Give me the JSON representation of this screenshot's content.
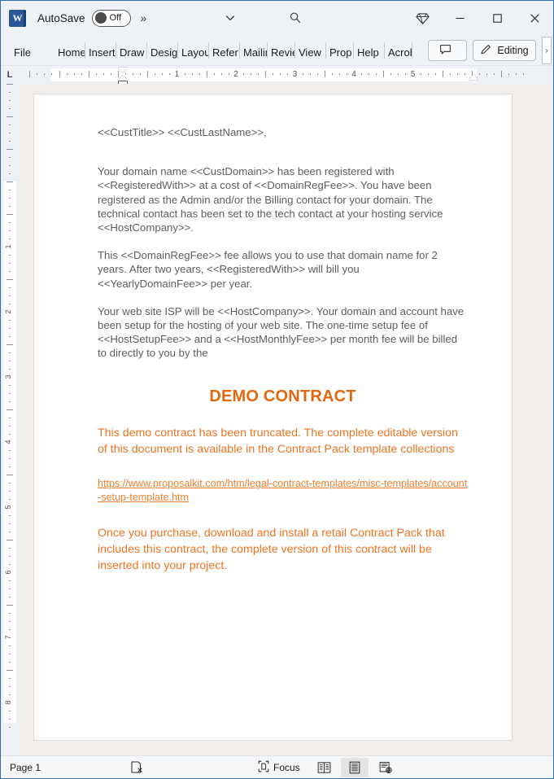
{
  "titlebar": {
    "app_icon": "word-logo-icon",
    "autosave_label": "AutoSave",
    "autosave_state": "Off",
    "more_chevron": "»",
    "customize_icon": "chevron-down-icon",
    "search_icon": "search-icon",
    "premium_icon": "diamond-icon",
    "minimize_icon": "minimize-icon",
    "maximize_icon": "maximize-icon",
    "close_icon": "close-icon"
  },
  "ribbon": {
    "tabs": [
      {
        "label": "File"
      },
      {
        "label": "Home"
      },
      {
        "label": "Insert"
      },
      {
        "label": "Draw"
      },
      {
        "label": "Design"
      },
      {
        "label": "Layout"
      },
      {
        "label": "Refer"
      },
      {
        "label": "Mailin"
      },
      {
        "label": "Revie"
      },
      {
        "label": "View"
      },
      {
        "label": "Prop"
      },
      {
        "label": "Help"
      },
      {
        "label": "Acrob"
      }
    ],
    "comments_label": "",
    "comments_icon": "comment-icon",
    "editing_label": "Editing",
    "editing_icon": "pencil-icon",
    "expand_label": "›"
  },
  "ruler": {
    "tabstop_marker": "L",
    "h_numbers": [
      "1",
      "2",
      "3",
      "4",
      "5"
    ],
    "v_numbers": [
      "1",
      "2",
      "3",
      "4",
      "5",
      "6",
      "7",
      "8"
    ]
  },
  "document": {
    "paragraphs": [
      {
        "id": "salutation",
        "style": "plain-spaced",
        "text": "<<CustTitle>> <<CustLastName>>,"
      },
      {
        "id": "domain-registration",
        "style": "plain",
        "text": "Your domain name <<CustDomain>> has been registered with <<RegisteredWith>> at a cost of <<DomainRegFee>>.   You have been registered as the Admin and/or the Billing contact for your domain.  The technical contact has been set to the tech contact at your hosting service <<HostCompany>>."
      },
      {
        "id": "domain-fee-terms",
        "style": "plain",
        "text": "This <<DomainRegFee>> fee allows you to use that domain name for 2 years. After two years, <<RegisteredWith>> will bill you <<YearlyDomainFee>> per year."
      },
      {
        "id": "isp-hosting",
        "style": "plain",
        "text": "Your web site ISP will be <<HostCompany>>.   Your domain and account have been setup for the hosting of your web site.   The one-time setup fee of <<HostSetupFee>> and a <<HostMonthlyFee>> per month fee will be billed to directly to you by the"
      }
    ],
    "demo_title": "DEMO CONTRACT",
    "demo_notice": "This demo contract has been truncated. The complete editable version of this document is available in the Contract Pack template collections",
    "demo_link": "https://www.proposalkit.com/htm/legal-contract-templates/misc-templates/account-setup-template.htm",
    "demo_purchase": "Once you purchase, download and install a retail Contract Pack that includes this contract, the complete version of this contract will be inserted into your project."
  },
  "statusbar": {
    "page_label": "Page 1",
    "proofing_icon": "proofing-errors-icon",
    "focus_label": "Focus",
    "focus_icon": "focus-icon",
    "view_read_icon": "read-mode-icon",
    "view_print_icon": "print-layout-icon",
    "view_web_icon": "web-layout-icon"
  },
  "colors": {
    "accent_orange": "#ec7423",
    "title_orange": "#e2680f",
    "link_orange": "#ef8030",
    "body_gray": "#5d5d5d",
    "window_border": "#2f6fb5",
    "chrome_bg": "#eef2f7",
    "canvas_bg": "#f1edea",
    "word_blue": "#2b579a"
  }
}
